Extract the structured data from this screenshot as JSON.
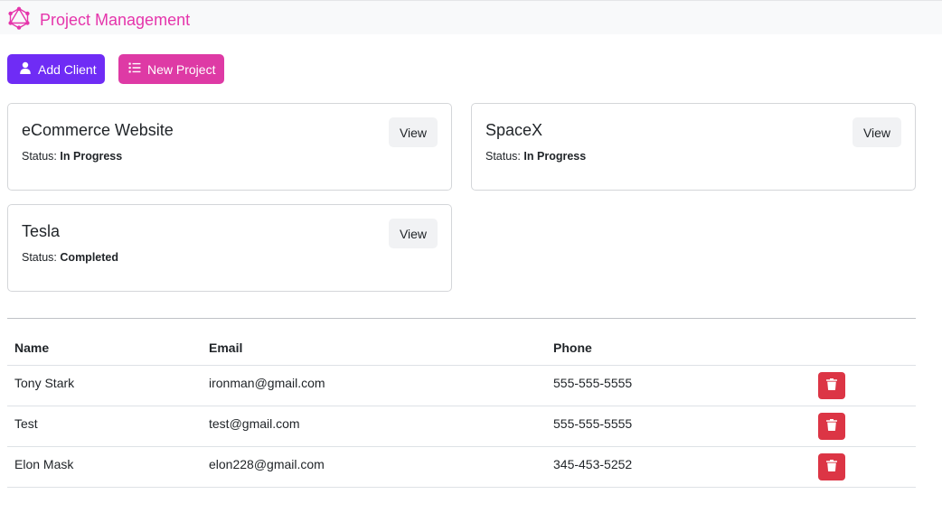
{
  "header": {
    "title": "Project Management",
    "logo_icon": "graphql-logo-icon",
    "accent_color": "#e535ab"
  },
  "toolbar": {
    "add_client_label": "Add Client",
    "add_client_icon": "user-icon",
    "add_client_color": "#6f2cf5",
    "new_project_label": "New Project",
    "new_project_icon": "list-icon",
    "new_project_color": "#de3aa5"
  },
  "projects": [
    {
      "name": "eCommerce Website",
      "status_label": "Status:",
      "status": "In Progress",
      "view_label": "View"
    },
    {
      "name": "SpaceX",
      "status_label": "Status:",
      "status": "In Progress",
      "view_label": "View"
    },
    {
      "name": "Tesla",
      "status_label": "Status:",
      "status": "Completed",
      "view_label": "View"
    }
  ],
  "clients": {
    "columns": [
      "Name",
      "Email",
      "Phone"
    ],
    "rows": [
      {
        "name": "Tony Stark",
        "email": "ironman@gmail.com",
        "phone": "555-555-5555"
      },
      {
        "name": "Test",
        "email": "test@gmail.com",
        "phone": "555-555-5555"
      },
      {
        "name": "Elon Mask",
        "email": "elon228@gmail.com",
        "phone": "345-453-5252"
      }
    ],
    "delete_icon": "trash-icon",
    "delete_color": "#dc3545"
  }
}
